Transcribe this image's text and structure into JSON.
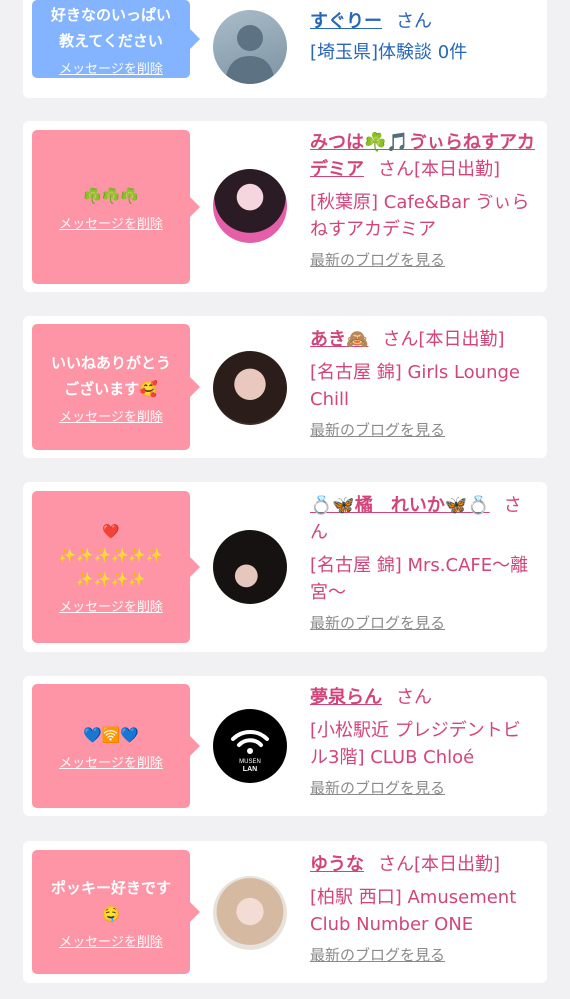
{
  "colors": {
    "bubble_blue": "#84b4ff",
    "bubble_pink": "#fe95a6",
    "name_pink": "#d2457b",
    "name_blue": "#2866b8",
    "blog_gray": "#8a8a8a"
  },
  "cards": [
    {
      "message": "好きなのいっぱい\n教えてください",
      "delete_label": "メッセージを削除",
      "name": "すぐりー",
      "suffix": "さん",
      "place": "[埼玉県]体験談 0件",
      "blog_label": "",
      "avatar_icon": "no-photo-avatar",
      "avatar_text": "no photo"
    },
    {
      "message": "☘️☘️☘️",
      "delete_label": "メッセージを削除",
      "name": "みつは☘️🎵ゔぃらねすアカデミア",
      "suffix": "さん[本日出勤]",
      "place": "[秋葉原] Cafe&Bar ゔぃらねすアカデミア",
      "blog_label": "最新のブログを見る",
      "avatar_icon": "user-photo-avatar"
    },
    {
      "message": "いいねありがとう\nございます🥰",
      "delete_label": "メッセージを削除",
      "name": "あき🙈",
      "suffix": "さん[本日出勤]",
      "place": "[名古屋 錦] Girls Lounge Chill",
      "blog_label": "最新のブログを見る",
      "avatar_icon": "user-photo-avatar"
    },
    {
      "message": "❤️\n✨✨✨✨✨✨\n✨✨✨✨",
      "delete_label": "メッセージを削除",
      "name": "💍🦋橘　れいか🦋💍",
      "suffix": "さん",
      "place": "[名古屋 錦] Mrs.CAFE〜離宮〜",
      "blog_label": "最新のブログを見る",
      "avatar_icon": "user-photo-avatar"
    },
    {
      "message": "💙🛜💙",
      "delete_label": "メッセージを削除",
      "name": "夢泉らん",
      "suffix": "さん",
      "place": "[小松駅近 プレジデントビル3階] CLUB Chloé",
      "blog_label": "最新のブログを見る",
      "avatar_icon": "wifi-logo-avatar",
      "avatar_text": "MUSEN\nLAN"
    },
    {
      "message": "ポッキー好きです\n🤤",
      "delete_label": "メッセージを削除",
      "name": "ゆうな",
      "suffix": "さん[本日出勤]",
      "place": "[柏駅 西口] Amusement Club Number ONE",
      "blog_label": "最新のブログを見る",
      "avatar_icon": "user-photo-avatar"
    }
  ]
}
